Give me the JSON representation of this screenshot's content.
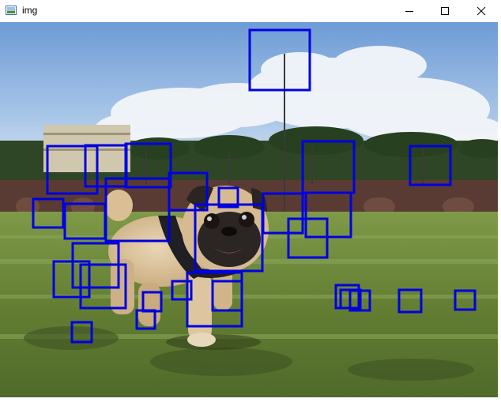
{
  "window": {
    "title": "img",
    "icon": "image-window-icon",
    "controls": {
      "minimize": "minimize-icon",
      "maximize": "maximize-icon",
      "close": "close-icon"
    }
  },
  "image": {
    "subject": "pug",
    "box_color": "#0000e0",
    "detections_count": 35
  },
  "colors": {
    "sky_top": "#7fa9db",
    "sky_bottom": "#d7e4f2",
    "grass": "#6f8a3c",
    "box": "#0000e0"
  }
}
